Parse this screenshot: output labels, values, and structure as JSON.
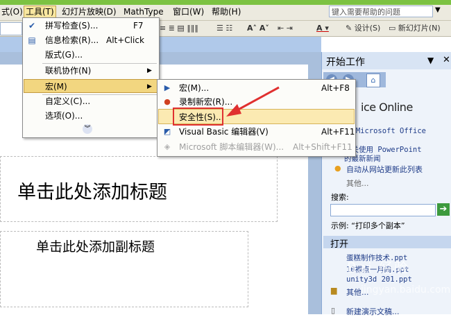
{
  "menubar": {
    "items": [
      "式(O)",
      "工具(T)",
      "幻灯片放映(D)",
      "MathType",
      "窗口(W)",
      "帮助(H)"
    ],
    "help_placeholder": "键入需要帮助的问题"
  },
  "toolbar": {
    "design_label": "设计(S)",
    "new_slide_label": "新幻灯片(N)"
  },
  "tools_menu": {
    "items": [
      {
        "label": "拼写检查(S)...",
        "shortcut": "F7"
      },
      {
        "label": "信息检索(R)...",
        "shortcut": "Alt+Click"
      },
      {
        "label": "版式(G)...",
        "shortcut": ""
      },
      {
        "label": "联机协作(N)",
        "shortcut": ""
      },
      {
        "label": "宏(M)",
        "shortcut": ""
      },
      {
        "label": "自定义(C)...",
        "shortcut": ""
      },
      {
        "label": "选项(O)...",
        "shortcut": ""
      }
    ]
  },
  "macro_menu": {
    "items": [
      {
        "label": "宏(M)...",
        "shortcut": "Alt+F8"
      },
      {
        "label": "录制新宏(R)...",
        "shortcut": ""
      },
      {
        "label": "安全性(S)...",
        "shortcut": ""
      },
      {
        "label": "Visual Basic 编辑器(V)",
        "shortcut": "Alt+F11"
      },
      {
        "label": "Microsoft 脚本编辑器(W)...",
        "shortcut": "Alt+Shift+F11"
      }
    ]
  },
  "slide": {
    "title_placeholder": "单击此处添加标题",
    "subtitle_placeholder": "单击此处添加副标题"
  },
  "task_pane": {
    "title": "开始工作",
    "office_online": "ice Online",
    "links": [
      "到 Microsoft Office",
      "ne",
      "有关使用 PowerPoint",
      "的最新新闻",
      "自动从网站更新此列表",
      "其他..."
    ],
    "search_label": "搜索:",
    "example": "示例: “打印多个副本”",
    "open_title": "打开",
    "recent_files": [
      "蛋糕制作技术.ppt",
      "10裸点一月闹.ppt",
      "unity3d 201.ppt",
      "其他..."
    ],
    "new_presentation": "新建演示文稿..."
  },
  "watermark": {
    "text": "百度经验",
    "url": "jingyan.baidu.com"
  }
}
